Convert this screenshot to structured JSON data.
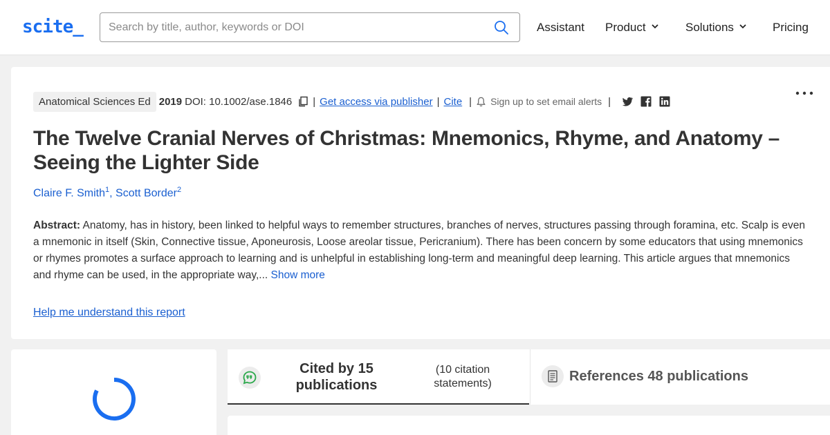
{
  "header": {
    "logo": "scite_",
    "search_placeholder": "Search by title, author, keywords or DOI",
    "nav": [
      {
        "label": "Assistant",
        "dropdown": false
      },
      {
        "label": "Product",
        "dropdown": true
      },
      {
        "label": "Solutions",
        "dropdown": true
      },
      {
        "label": "Pricing",
        "dropdown": false
      }
    ]
  },
  "paper": {
    "journal": "Anatomical Sciences Ed",
    "year": "2019",
    "doi": "DOI: 10.1002/ase.1846",
    "access_link": "Get access via publisher",
    "cite_link": "Cite",
    "alerts": "Sign up to set email alerts",
    "title": "The Twelve Cranial Nerves of Christmas: Mnemonics, Rhyme, and Anatomy – Seeing the Lighter Side",
    "authors": [
      {
        "name": "Claire F. Smith",
        "affil": "1"
      },
      {
        "name": "Scott Border",
        "affil": "2"
      }
    ],
    "abstract_label": "Abstract:",
    "abstract": "Anatomy, has in history, been linked to helpful ways to remember structures, branches of nerves, structures passing through foramina, etc. Scalp is even a mnemonic in itself (Skin, Connective tissue, Aponeurosis, Loose areolar tissue, Pericranium). There has been concern by some educators that using mnemonics or rhymes promotes a surface approach to learning and is unhelpful in establishing long-term and meaningful deep learning. This article argues that mnemonics and rhyme can be used, in the appropriate way,...",
    "show_more": "Show more",
    "help_link": "Help me understand this report"
  },
  "tabs": {
    "cited": "Cited by 15 publications",
    "citation_statements": "(10 citation statements)",
    "references": "References 48 publications"
  },
  "colors": {
    "accent": "#1a6ef0",
    "link": "#1a5fd0",
    "chat_icon": "#2aa84a"
  },
  "icons": [
    "search-icon",
    "chevron-down-icon",
    "copy-icon",
    "bell-icon",
    "twitter-icon",
    "facebook-icon",
    "linkedin-icon",
    "more-icon",
    "loading-spinner",
    "chat-quote-icon",
    "document-icon"
  ]
}
